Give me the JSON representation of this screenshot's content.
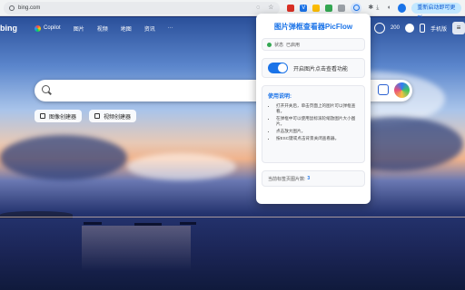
{
  "browser": {
    "url": "bing.com",
    "restart_label": "重新启动即可更新",
    "colors": {
      "accent": "#1a73e8",
      "toolbar": "#f1f3f4"
    }
  },
  "bing": {
    "logo": "bing",
    "nav": [
      {
        "label": "Copilot"
      },
      {
        "label": "图片"
      },
      {
        "label": "视频"
      },
      {
        "label": "地图"
      },
      {
        "label": "资讯"
      },
      {
        "label": "···"
      }
    ],
    "rewards_count": "200",
    "phone_label": "手机版",
    "chips": [
      {
        "label": "图像创建器"
      },
      {
        "label": "视频创建器"
      }
    ]
  },
  "popup": {
    "title": "图片弹框查看器PicFlow",
    "status_label": "状态",
    "status_value": "已启用",
    "toggle_label": "开启图片点击查看功能",
    "toggle_on": true,
    "usage_title": "使用说明:",
    "usage_items": [
      "打开开关后，单击页面上的图片可以弹框查看。",
      "在弹框中可以使用鼠标滚轮缩放图片大小图片。",
      "点击放大图片。",
      "按ESC键或点击背景关闭查看器。"
    ],
    "count_label": "当前标签页图片数:",
    "count_value": "3"
  }
}
